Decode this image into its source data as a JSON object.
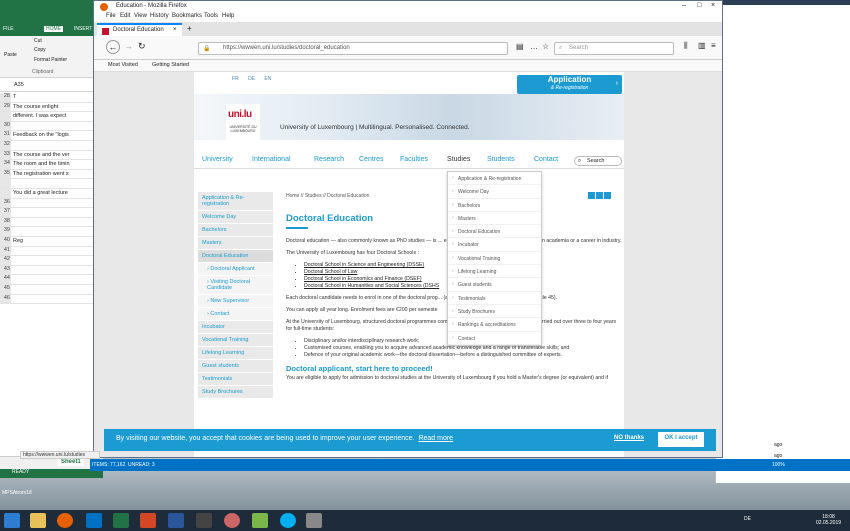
{
  "excel": {
    "title_cells": "",
    "tabs": [
      "FILE",
      "HOME",
      "INSERT"
    ],
    "clipboard": {
      "cut": "Cut",
      "copy": "Copy",
      "format_painter": "Format Painter",
      "paste": "Paste",
      "group": "Clipboard"
    },
    "namebox": "A35",
    "rows": [
      {
        "n": "28",
        "v": "T"
      },
      {
        "n": "29",
        "v": "   The course enlight"
      },
      {
        "n": "",
        "v": "different. I was expect"
      },
      {
        "n": "30",
        "v": ""
      },
      {
        "n": "31",
        "v": "Feedback on the \"logis"
      },
      {
        "n": "32",
        "v": ""
      },
      {
        "n": "33",
        "v": "The course and the ver"
      },
      {
        "n": "34",
        "v": "The room and the timin"
      },
      {
        "n": "35",
        "v": "The registration went s"
      },
      {
        "n": "",
        "v": ""
      },
      {
        "n": "",
        "v": "You did a great lecture"
      },
      {
        "n": "36",
        "v": ""
      },
      {
        "n": "37",
        "v": ""
      },
      {
        "n": "38",
        "v": ""
      },
      {
        "n": "39",
        "v": ""
      },
      {
        "n": "40",
        "v": "Reg"
      },
      {
        "n": "41",
        "v": ""
      },
      {
        "n": "42",
        "v": ""
      },
      {
        "n": "43",
        "v": ""
      },
      {
        "n": "44",
        "v": ""
      },
      {
        "n": "45",
        "v": ""
      },
      {
        "n": "46",
        "v": ""
      }
    ],
    "sheet": "Sheet1",
    "status": "READY",
    "bottom_label": "MPSAtrom18"
  },
  "outlook": {
    "items": "ITEMS: 77,162",
    "unread": "UNREAD: 3",
    "right_time1": "ago",
    "right_time2": "ago",
    "zoom": "100%"
  },
  "firefox": {
    "window_title": "Education - Mozilla Firefox",
    "menu": [
      "File",
      "Edit",
      "View",
      "History",
      "Bookmarks",
      "Tools",
      "Help"
    ],
    "tab_title": "Doctoral Education",
    "url": "https://wwwen.uni.lu/studies/doctoral_education",
    "search_placeholder": "Search",
    "bookmarks": [
      "Most Visited",
      "Getting Started"
    ],
    "status_url": "https://wwwen.uni.lu/studies"
  },
  "page": {
    "langs": [
      "FR",
      "DE",
      "EN"
    ],
    "application": {
      "title": "Application",
      "subtitle": "& Re-registration"
    },
    "logo": {
      "mark": "uni.lu",
      "line1": "UNIVERSITÉ DU",
      "line2": "LUXEMBOURG"
    },
    "tagline": "University of Luxembourg | Multilingual. Personalised. Connected.",
    "nav": [
      "University",
      "International",
      "Research",
      "Centres",
      "Faculties",
      "Studies",
      "Students",
      "Contact"
    ],
    "search": "Search",
    "breadcrumb": "Home // Studies // Doctoral Education",
    "sidebar": [
      {
        "label": "Application & Re-registration",
        "sub": false
      },
      {
        "label": "Welcome Day",
        "sub": false
      },
      {
        "label": "Bachelors",
        "sub": false
      },
      {
        "label": "Masters",
        "sub": false
      },
      {
        "label": "Doctoral Education",
        "sub": false
      },
      {
        "label": "› Doctoral Applicant",
        "sub": true
      },
      {
        "label": "› Visiting Doctoral Candidate",
        "sub": true
      },
      {
        "label": "› New Supervisor",
        "sub": true
      },
      {
        "label": "› Contact",
        "sub": true
      },
      {
        "label": "Incubator",
        "sub": false
      },
      {
        "label": "Vocational Training",
        "sub": false
      },
      {
        "label": "Lifelong Learning",
        "sub": false
      },
      {
        "label": "Guest students",
        "sub": false
      },
      {
        "label": "Testimonials",
        "sub": false
      },
      {
        "label": "Study Brochures",
        "sub": false
      }
    ],
    "title": "Doctoral Education",
    "p1": "Doctoral education — also commonly known as PhD studies — is ... er, whether you intend to pursue research in academia or a career in industry.",
    "p2": "The University of Luxembourg has four Doctoral Schools :",
    "schools": [
      "Doctoral School in Science and Engineering (DSSE)",
      "Doctoral School of Law",
      "Doctoral School in Economics and Finance (DSEF)",
      "Doctoral School in Humanities and Social Sciences (DSHS"
    ],
    "p3": "Each doctoral candidate needs to enrol in one of the doctoral prog... (according to the law of 27 June 2018, article 45).",
    "p4": "You can apply all year long. Enrolment fees are €200 per semeste",
    "p5": "At the University of Luxembourg, structured doctoral programmes combine coursework and research phases carried out over three to four years for full-time students:",
    "bullets": [
      "Disciplinary and/or interdisciplinary research work;",
      "Customised courses, enabling you to acquire advanced academic knowledge and a range of transferable skills; and",
      "Defence of your original academic work—the doctoral dissertation—before a distinguished committee of experts."
    ],
    "h2": "Doctoral applicant, start here to proceed!",
    "p6": "You are eligible to apply for admission to doctoral studies at the University of Luxembourg if you hold a Master's degree (or equivalent) and if",
    "dropdown": [
      "Application & Re-registration",
      "Welcome Day",
      "Bachelors",
      "Masters",
      "Doctoral Education",
      "Incubator",
      "Vocational Training",
      "Lifelong Learning",
      "Guest students",
      "Testimonials",
      "Study Brochures",
      "Rankings & accreditations",
      "Contact"
    ],
    "cookie": {
      "text": "By visiting our website, you accept that cookies are being used to improve your user experience.",
      "read_more": "Read more",
      "no_thanks": "NO thanks",
      "ok": "OK I accept"
    }
  },
  "taskbar": {
    "lang": "DE",
    "time": "18:08",
    "date": "02.05.2019"
  }
}
